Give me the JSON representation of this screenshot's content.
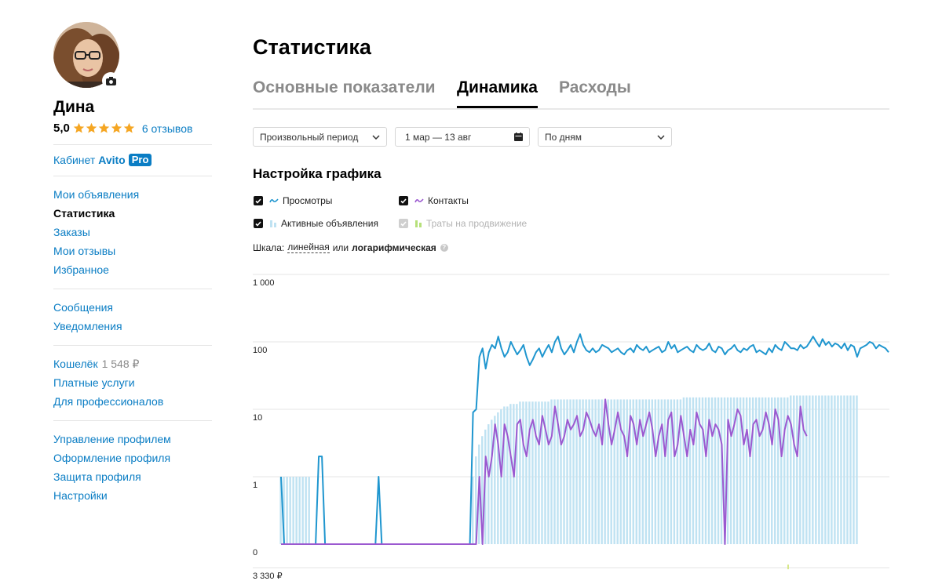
{
  "sidebar": {
    "user_name": "Дина",
    "rating": "5,0",
    "stars": 5,
    "reviews_link": "6 отзывов",
    "cabinet_label": "Кабинет",
    "cabinet_brand": "Avito",
    "cabinet_badge": "Pro",
    "menu_group_1": [
      "Мои объявления",
      "Статистика",
      "Заказы",
      "Мои отзывы",
      "Избранное"
    ],
    "active_item": "Статистика",
    "menu_group_2": [
      "Сообщения",
      "Уведомления"
    ],
    "wallet_label": "Кошелёк",
    "wallet_amount": "1 548 ₽",
    "menu_group_3": [
      "Платные услуги",
      "Для профессионалов"
    ],
    "menu_group_4": [
      "Управление профилем",
      "Оформление профиля",
      "Защита профиля",
      "Настройки"
    ]
  },
  "page": {
    "title": "Статистика",
    "tabs": [
      "Основные показатели",
      "Динамика",
      "Расходы"
    ],
    "active_tab": "Динамика"
  },
  "filters": {
    "period": "Произвольный период",
    "date_range": "1 мар — 13 авг",
    "grouping": "По дням"
  },
  "chart_settings": {
    "title": "Настройка графика",
    "options": [
      {
        "label": "Просмотры",
        "checked": true,
        "enabled": true,
        "color": "#1f96cf"
      },
      {
        "label": "Контакты",
        "checked": true,
        "enabled": true,
        "color": "#9b59d0"
      },
      {
        "label": "Активные объявления",
        "checked": true,
        "enabled": true,
        "color": "#bfe2f2"
      },
      {
        "label": "Траты на продвижение",
        "checked": true,
        "enabled": false,
        "color": "#b6e07a"
      }
    ],
    "scale_label": "Шкала:",
    "scale_linear": "линейная",
    "scale_or": "или",
    "scale_log": "логарифмическая",
    "scale_selected": "логарифмическая"
  },
  "chart_data": {
    "type": "line",
    "scale": "log",
    "ytick_labels": [
      "1 000",
      "100",
      "10",
      "1",
      "0"
    ],
    "yticks": [
      1000,
      100,
      10,
      1,
      0
    ],
    "grid": true,
    "x": "days 1 мар — 13 авг",
    "series": [
      {
        "name": "Просмотры",
        "type": "line",
        "color": "#1f96cf",
        "values": [
          1,
          0,
          0,
          0,
          0,
          0,
          0,
          0,
          0,
          0,
          0,
          0,
          2,
          2,
          0,
          0,
          0,
          0,
          0,
          0,
          0,
          0,
          0,
          0,
          0,
          0,
          0,
          0,
          0,
          0,
          0,
          1,
          0,
          0,
          0,
          0,
          0,
          0,
          0,
          0,
          0,
          0,
          0,
          0,
          0,
          0,
          0,
          0,
          0,
          0,
          0,
          0,
          0,
          0,
          0,
          0,
          0,
          0,
          0,
          0,
          0,
          9,
          10,
          60,
          80,
          40,
          70,
          90,
          80,
          120,
          80,
          60,
          70,
          100,
          80,
          65,
          75,
          90,
          60,
          45,
          55,
          70,
          80,
          60,
          75,
          90,
          70,
          100,
          120,
          80,
          65,
          75,
          90,
          70,
          100,
          130,
          90,
          75,
          70,
          80,
          70,
          75,
          90,
          85,
          80,
          70,
          75,
          80,
          70,
          65,
          75,
          80,
          70,
          90,
          80,
          75,
          85,
          70,
          75,
          80,
          85,
          70,
          75,
          100,
          80,
          90,
          70,
          75,
          80,
          85,
          75,
          70,
          90,
          80,
          75,
          80,
          95,
          75,
          70,
          85,
          80,
          65,
          75,
          80,
          90,
          75,
          70,
          80,
          75,
          85,
          90,
          70,
          75,
          70,
          65,
          80,
          70,
          90,
          80,
          75,
          100,
          90,
          80,
          80,
          75,
          90,
          80,
          85,
          100,
          120,
          100,
          85,
          110,
          90,
          100,
          85,
          95,
          90,
          80,
          95,
          75,
          90,
          85,
          60,
          80,
          85,
          90,
          100,
          95,
          80,
          90,
          85,
          80,
          70
        ]
      },
      {
        "name": "Контакты",
        "type": "line",
        "color": "#9b59d0",
        "values": [
          0,
          0,
          0,
          0,
          0,
          0,
          0,
          0,
          0,
          0,
          0,
          0,
          0,
          0,
          0,
          0,
          0,
          0,
          0,
          0,
          0,
          0,
          0,
          0,
          0,
          0,
          0,
          0,
          0,
          0,
          0,
          0,
          0,
          0,
          0,
          0,
          0,
          0,
          0,
          0,
          0,
          0,
          0,
          0,
          0,
          0,
          0,
          0,
          0,
          0,
          0,
          0,
          0,
          0,
          0,
          0,
          0,
          0,
          0,
          0,
          0,
          0,
          0,
          1,
          0,
          2,
          1,
          2,
          6,
          3,
          1,
          6,
          4,
          2,
          1,
          6,
          7,
          3,
          2,
          5,
          7,
          4,
          3,
          8,
          5,
          3,
          4,
          11,
          6,
          3,
          4,
          7,
          5,
          6,
          8,
          4,
          5,
          9,
          7,
          5,
          4,
          6,
          3,
          14,
          6,
          3,
          5,
          9,
          5,
          4,
          2,
          8,
          6,
          3,
          7,
          4,
          6,
          9,
          5,
          2,
          4,
          6,
          2,
          7,
          9,
          2,
          3,
          8,
          4,
          2,
          5,
          3,
          9,
          6,
          5,
          2,
          7,
          4,
          6,
          5,
          3,
          0,
          7,
          4,
          6,
          10,
          8,
          3,
          5,
          2,
          6,
          7,
          4,
          5,
          9,
          6,
          3,
          10,
          7,
          2,
          5,
          8,
          6,
          3,
          2,
          11,
          5,
          4
        ]
      },
      {
        "name": "Активные объявления",
        "type": "bar",
        "color": "#bfe2f2",
        "values": [
          1,
          1,
          1,
          1,
          1,
          1,
          1,
          1,
          1,
          1,
          0,
          0,
          0,
          0,
          0,
          0,
          0,
          0,
          0,
          0,
          0,
          0,
          0,
          0,
          0,
          0,
          0,
          0,
          0,
          0,
          0,
          0,
          0,
          0,
          0,
          0,
          0,
          0,
          0,
          0,
          0,
          0,
          0,
          0,
          0,
          0,
          0,
          0,
          0,
          0,
          0,
          0,
          0,
          0,
          0,
          0,
          0,
          0,
          0,
          0,
          0,
          1,
          2,
          3,
          4,
          5,
          6,
          7,
          8,
          9,
          10,
          11,
          11,
          12,
          12,
          12,
          13,
          13,
          13,
          13,
          13,
          13,
          13,
          13,
          13,
          13,
          14,
          14,
          14,
          14,
          14,
          14,
          14,
          14,
          14,
          14,
          14,
          14,
          14,
          14,
          14,
          14,
          14,
          14,
          14,
          14,
          14,
          14,
          14,
          14,
          14,
          14,
          14,
          14,
          14,
          14,
          14,
          14,
          14,
          14,
          14,
          14,
          14,
          14,
          14,
          14,
          14,
          14,
          15,
          15,
          15,
          15,
          15,
          15,
          15,
          15,
          15,
          15,
          15,
          15,
          15,
          15,
          15,
          15,
          15,
          15,
          15,
          15,
          15,
          15,
          15,
          15,
          15,
          15,
          15,
          15,
          15,
          15,
          15,
          15,
          15,
          15,
          16,
          16,
          16,
          16,
          16,
          16,
          16,
          16,
          16,
          16,
          16,
          16,
          16,
          16,
          16,
          16,
          16,
          16,
          16,
          16,
          16,
          16
        ]
      }
    ]
  },
  "bottom_axis_label": "3 330 ₽"
}
